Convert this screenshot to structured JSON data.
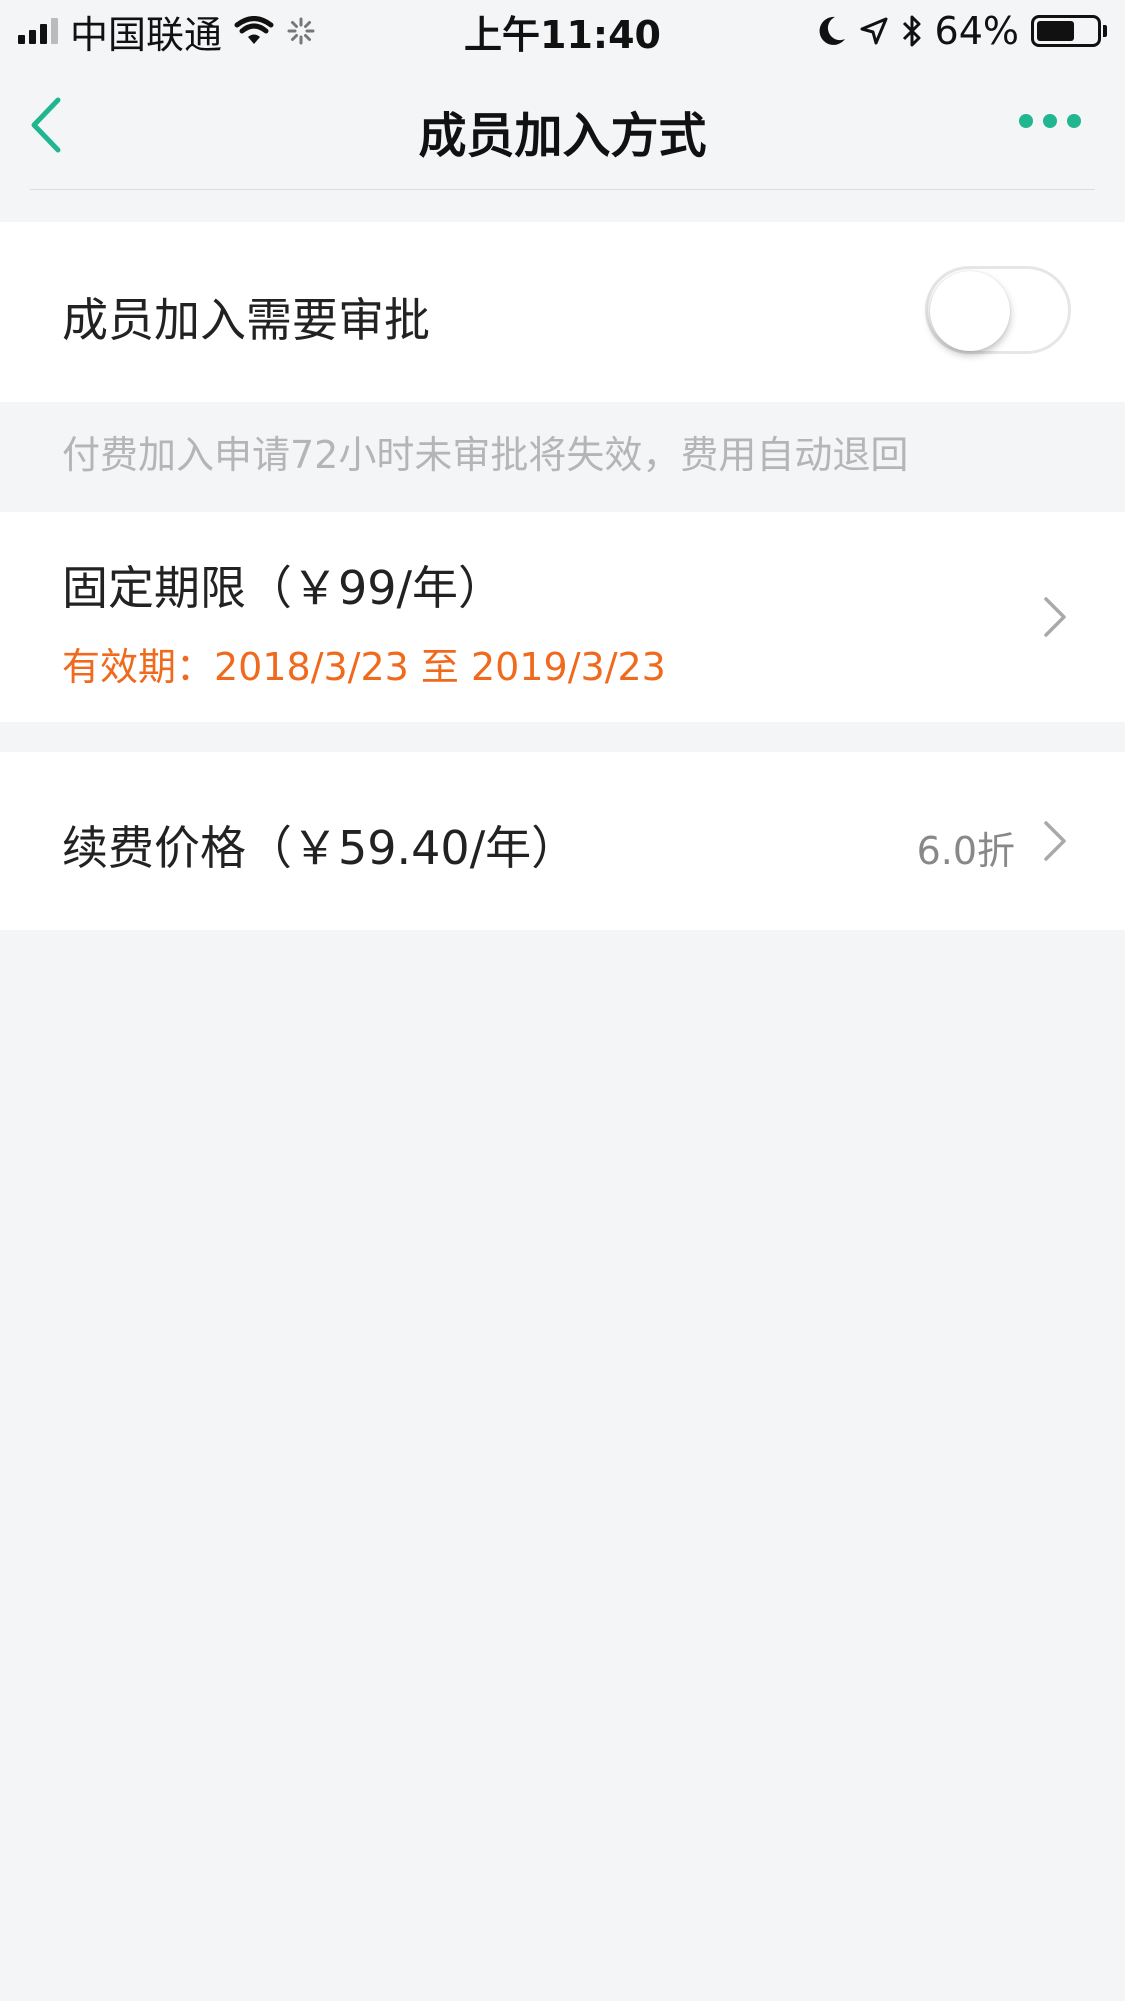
{
  "status_bar": {
    "carrier": "中国联通",
    "time": "上午11:40",
    "battery_percent": "64%",
    "battery_level": 0.64
  },
  "nav": {
    "title": "成员加入方式",
    "accent_color": "#20b68f"
  },
  "approval": {
    "label": "成员加入需要审批",
    "enabled": false
  },
  "hint_text": "付费加入申请72小时未审批将失效，费用自动退回",
  "fixed_term": {
    "label": "固定期限（￥99/年）",
    "validity": "有效期：2018/3/23 至 2019/3/23"
  },
  "renewal": {
    "label": "续费价格（￥59.40/年）",
    "discount": "6.0折"
  }
}
